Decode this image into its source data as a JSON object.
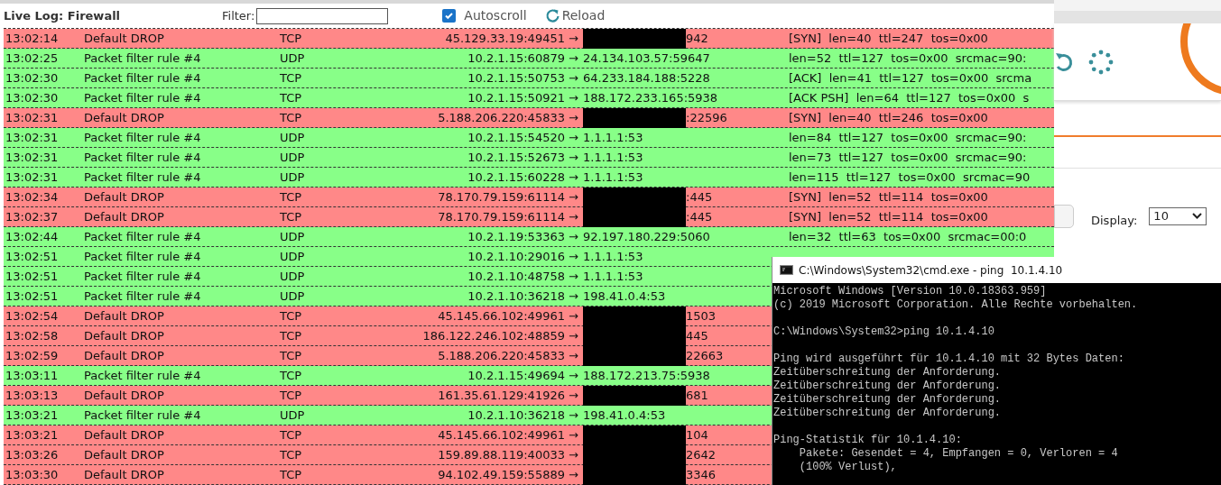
{
  "log": {
    "title": "Live Log: Firewall",
    "filter": {
      "label": "Filter:"
    },
    "autoscroll": {
      "label": "Autoscroll",
      "checked": true
    },
    "reload": {
      "label": "Reload"
    },
    "rows": [
      {
        "kind": "drop",
        "time": "13:02:14",
        "rule": "Default DROP",
        "proto": "TCP",
        "source": "45.129.33.19:49451 →",
        "redacted": true,
        "dest": "942",
        "info": "[SYN]  len=40  ttl=247  tos=0x00"
      },
      {
        "kind": "pass",
        "time": "13:02:25",
        "rule": "Packet filter rule #4",
        "proto": "UDP",
        "source": "10.2.1.15:60879 →",
        "redacted": false,
        "dest": "24.134.103.57:59647",
        "info": "len=52  ttl=127  tos=0x00  srcmac=90:"
      },
      {
        "kind": "pass",
        "time": "13:02:30",
        "rule": "Packet filter rule #4",
        "proto": "TCP",
        "source": "10.2.1.15:50753 →",
        "redacted": false,
        "dest": "64.233.184.188:5228",
        "info": "[ACK]  len=41  ttl=127  tos=0x00  srcma"
      },
      {
        "kind": "pass",
        "time": "13:02:30",
        "rule": "Packet filter rule #4",
        "proto": "TCP",
        "source": "10.2.1.15:50921 →",
        "redacted": false,
        "dest": "188.172.233.165:5938",
        "info": "[ACK PSH]  len=64  ttl=127  tos=0x00  s"
      },
      {
        "kind": "drop",
        "time": "13:02:31",
        "rule": "Default DROP",
        "proto": "TCP",
        "source": "5.188.206.220:45833 →",
        "redacted": true,
        "dest": ":22596",
        "info": "[SYN]  len=40  ttl=246  tos=0x00"
      },
      {
        "kind": "pass",
        "time": "13:02:31",
        "rule": "Packet filter rule #4",
        "proto": "UDP",
        "source": "10.2.1.15:54520 →",
        "redacted": false,
        "dest": "1.1.1.1:53",
        "info": "len=84  ttl=127  tos=0x00  srcmac=90:"
      },
      {
        "kind": "pass",
        "time": "13:02:31",
        "rule": "Packet filter rule #4",
        "proto": "UDP",
        "source": "10.2.1.15:52673 →",
        "redacted": false,
        "dest": "1.1.1.1:53",
        "info": "len=73  ttl=127  tos=0x00  srcmac=90:"
      },
      {
        "kind": "pass",
        "time": "13:02:31",
        "rule": "Packet filter rule #4",
        "proto": "UDP",
        "source": "10.2.1.15:60228 →",
        "redacted": false,
        "dest": "1.1.1.1:53",
        "info": "len=115  ttl=127  tos=0x00  srcmac=90"
      },
      {
        "kind": "drop",
        "time": "13:02:34",
        "rule": "Default DROP",
        "proto": "TCP",
        "source": "78.170.79.159:61114 →",
        "redacted": true,
        "dest": ":445",
        "info": "[SYN]  len=52  ttl=114  tos=0x00"
      },
      {
        "kind": "drop",
        "time": "13:02:37",
        "rule": "Default DROP",
        "proto": "TCP",
        "source": "78.170.79.159:61114 →",
        "redacted": true,
        "dest": ":445",
        "info": "[SYN]  len=52  ttl=114  tos=0x00"
      },
      {
        "kind": "pass",
        "time": "13:02:44",
        "rule": "Packet filter rule #4",
        "proto": "UDP",
        "source": "10.2.1.19:53363 →",
        "redacted": false,
        "dest": "92.197.180.229:5060",
        "info": "len=32  ttl=63  tos=0x00  srcmac=00:0"
      },
      {
        "kind": "pass",
        "time": "13:02:51",
        "rule": "Packet filter rule #4",
        "proto": "UDP",
        "source": "10.2.1.10:29016 →",
        "redacted": false,
        "dest": "1.1.1.1:53"
      },
      {
        "kind": "pass",
        "time": "13:02:51",
        "rule": "Packet filter rule #4",
        "proto": "UDP",
        "source": "10.2.1.10:48758 →",
        "redacted": false,
        "dest": "1.1.1.1:53"
      },
      {
        "kind": "pass",
        "time": "13:02:51",
        "rule": "Packet filter rule #4",
        "proto": "UDP",
        "source": "10.2.1.10:36218 →",
        "redacted": false,
        "dest": "198.41.0.4:53"
      },
      {
        "kind": "drop",
        "time": "13:02:54",
        "rule": "Default DROP",
        "proto": "TCP",
        "source": "45.145.66.102:49961 →",
        "redacted": true,
        "dest": "1503"
      },
      {
        "kind": "drop",
        "time": "13:02:58",
        "rule": "Default DROP",
        "proto": "TCP",
        "source": "186.122.246.102:48859 →",
        "redacted": true,
        "dest": "445"
      },
      {
        "kind": "drop",
        "time": "13:02:59",
        "rule": "Default DROP",
        "proto": "TCP",
        "source": "5.188.206.220:45833 →",
        "redacted": true,
        "dest": "22663"
      },
      {
        "kind": "pass",
        "time": "13:03:11",
        "rule": "Packet filter rule #4",
        "proto": "TCP",
        "source": "10.2.1.15:49694 →",
        "redacted": false,
        "dest": "188.172.213.75:5938"
      },
      {
        "kind": "drop",
        "time": "13:03:13",
        "rule": "Default DROP",
        "proto": "TCP",
        "source": "161.35.61.129:41926 →",
        "redacted": true,
        "dest": "681"
      },
      {
        "kind": "pass",
        "time": "13:03:21",
        "rule": "Packet filter rule #4",
        "proto": "UDP",
        "source": "10.2.1.10:36218 →",
        "redacted": false,
        "dest": "198.41.0.4:53"
      },
      {
        "kind": "drop",
        "time": "13:03:21",
        "rule": "Default DROP",
        "proto": "TCP",
        "source": "45.145.66.102:49961 →",
        "redacted": true,
        "dest": "104"
      },
      {
        "kind": "drop",
        "time": "13:03:26",
        "rule": "Default DROP",
        "proto": "TCP",
        "source": "159.89.88.119:40033 →",
        "redacted": true,
        "dest": "2642"
      },
      {
        "kind": "drop",
        "time": "13:03:30",
        "rule": "Default DROP",
        "proto": "TCP",
        "source": "94.102.49.159:55889 →",
        "redacted": true,
        "dest": "3346"
      }
    ]
  },
  "background_page": {
    "display_label": "Display:",
    "display_value": "10"
  },
  "console": {
    "title": "C:\\Windows\\System32\\cmd.exe - ping  10.1.4.10",
    "blocks": [
      [
        "Microsoft Windows [Version 10.0.18363.959]",
        "(c) 2019 Microsoft Corporation. Alle Rechte vorbehalten."
      ],
      [
        "C:\\Windows\\System32>ping 10.1.4.10"
      ],
      [
        "Ping wird ausgeführt für 10.1.4.10 mit 32 Bytes Daten:",
        "Zeitüberschreitung der Anforderung.",
        "Zeitüberschreitung der Anforderung.",
        "Zeitüberschreitung der Anforderung.",
        "Zeitüberschreitung der Anforderung."
      ],
      [
        "Ping-Statistik für 10.1.4.10:",
        "    Pakete: Gesendet = 4, Empfangen = 0, Verloren = 4",
        "    (100% Verlust),"
      ]
    ]
  }
}
